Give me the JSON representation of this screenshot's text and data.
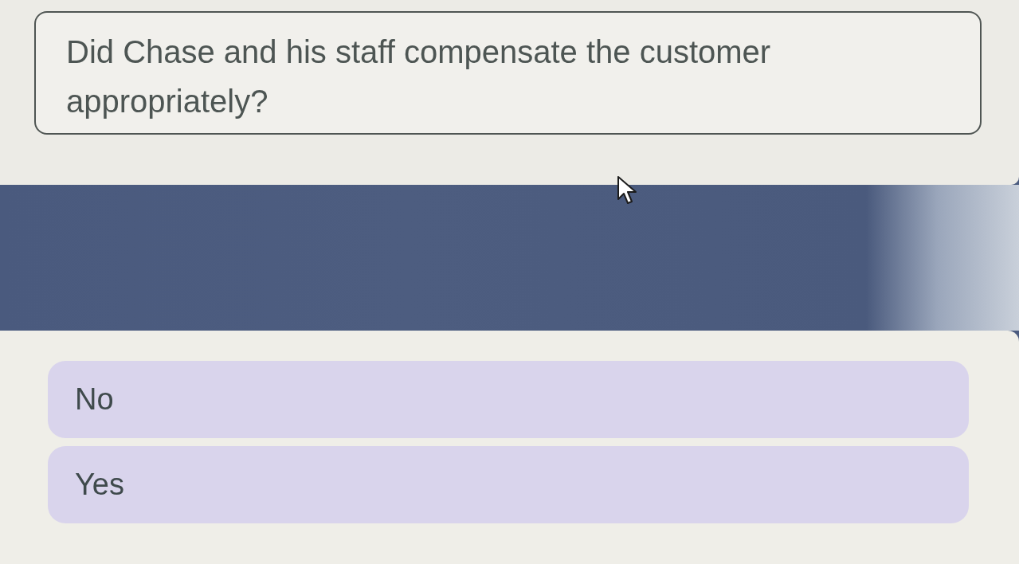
{
  "question": {
    "text": "Did Chase and his staff compensate the customer appropriately?"
  },
  "options": [
    {
      "label": "No",
      "selected": false
    },
    {
      "label": "Yes",
      "selected": false
    }
  ]
}
